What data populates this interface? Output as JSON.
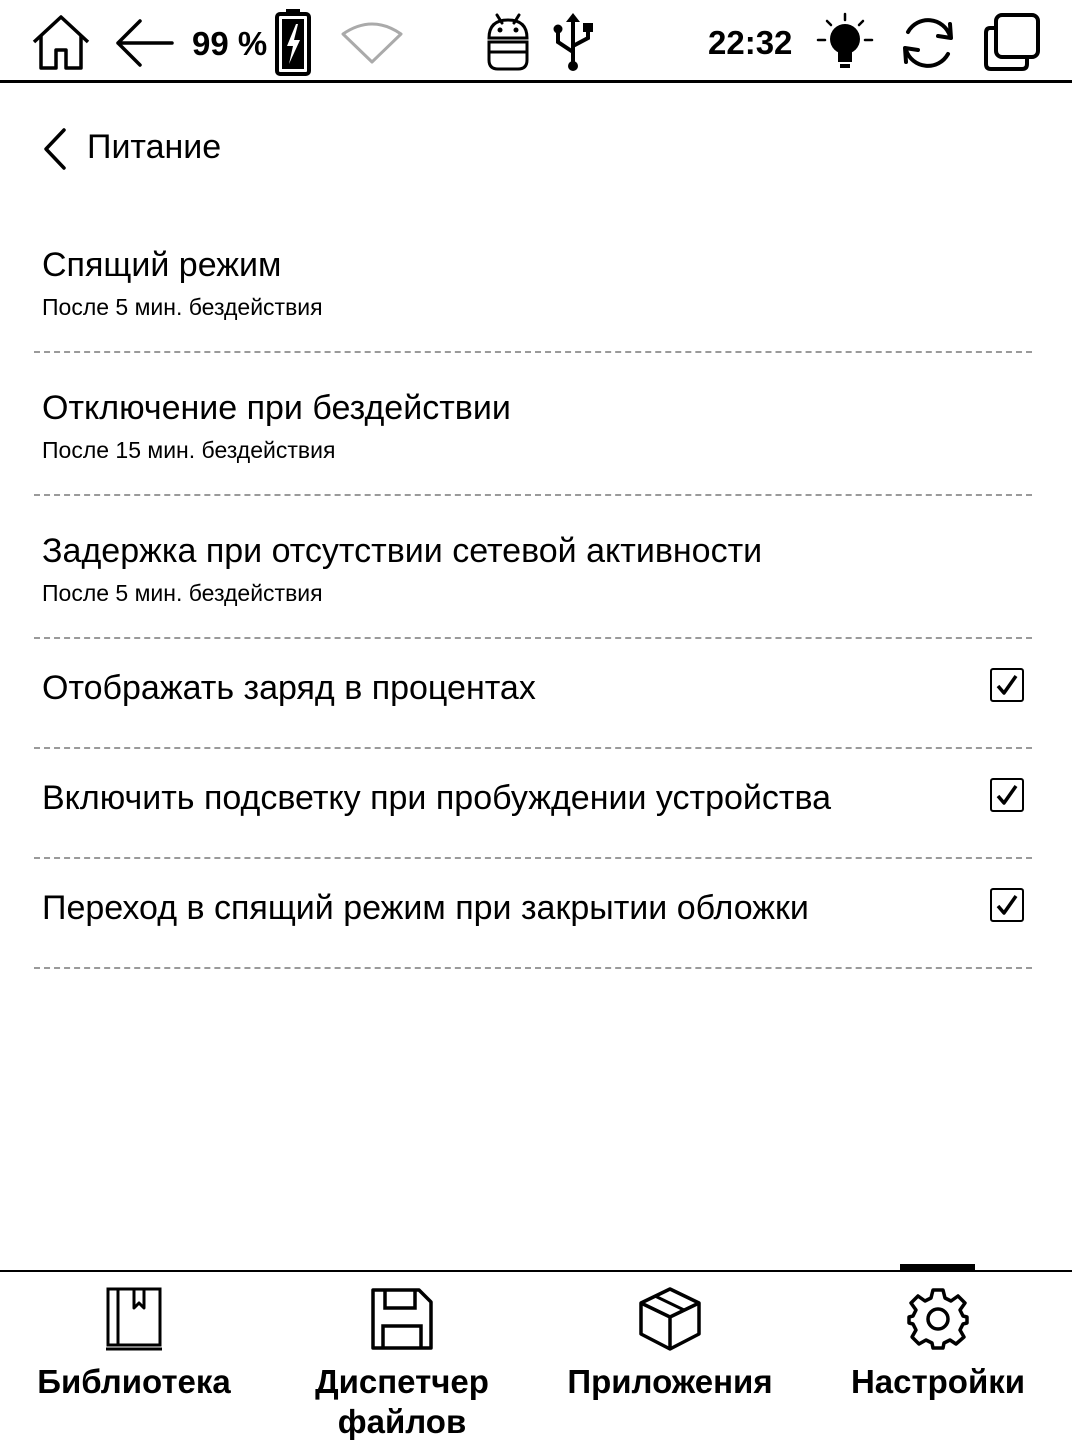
{
  "status_bar": {
    "battery_percent": "99 %",
    "time": "22:32",
    "icons": [
      "home-icon",
      "back-arrow-icon",
      "battery-charging-icon",
      "wifi-icon",
      "android-icon",
      "usb-icon",
      "frontlight-icon",
      "refresh-icon",
      "multitask-icon"
    ]
  },
  "header": {
    "title": "Питание",
    "back_icon": "chevron-left-icon"
  },
  "settings": [
    {
      "title": "Спящий режим",
      "subtitle": "После 5 мин. бездействия"
    },
    {
      "title": "Отключение при бездействии",
      "subtitle": "После 15 мин. бездействия"
    },
    {
      "title": "Задержка при отсутствии сетевой активности",
      "subtitle": "После 5 мин. бездействия"
    },
    {
      "title": "Отображать заряд в процентах",
      "checked": true
    },
    {
      "title": "Включить подсветку при пробуждении устройства",
      "checked": true
    },
    {
      "title": "Переход в спящий режим при закрытии обложки",
      "checked": true
    }
  ],
  "bottom_nav": {
    "active": "Настройки",
    "items": [
      {
        "label_line1": "Библиотека",
        "label_line2": "",
        "icon": "library-book-icon"
      },
      {
        "label_line1": "Диспетчер",
        "label_line2": "файлов",
        "icon": "floppy-disk-icon"
      },
      {
        "label_line1": "Приложения",
        "label_line2": "",
        "icon": "cube-icon"
      },
      {
        "label_line1": "Настройки",
        "label_line2": "",
        "icon": "gear-icon"
      }
    ]
  }
}
